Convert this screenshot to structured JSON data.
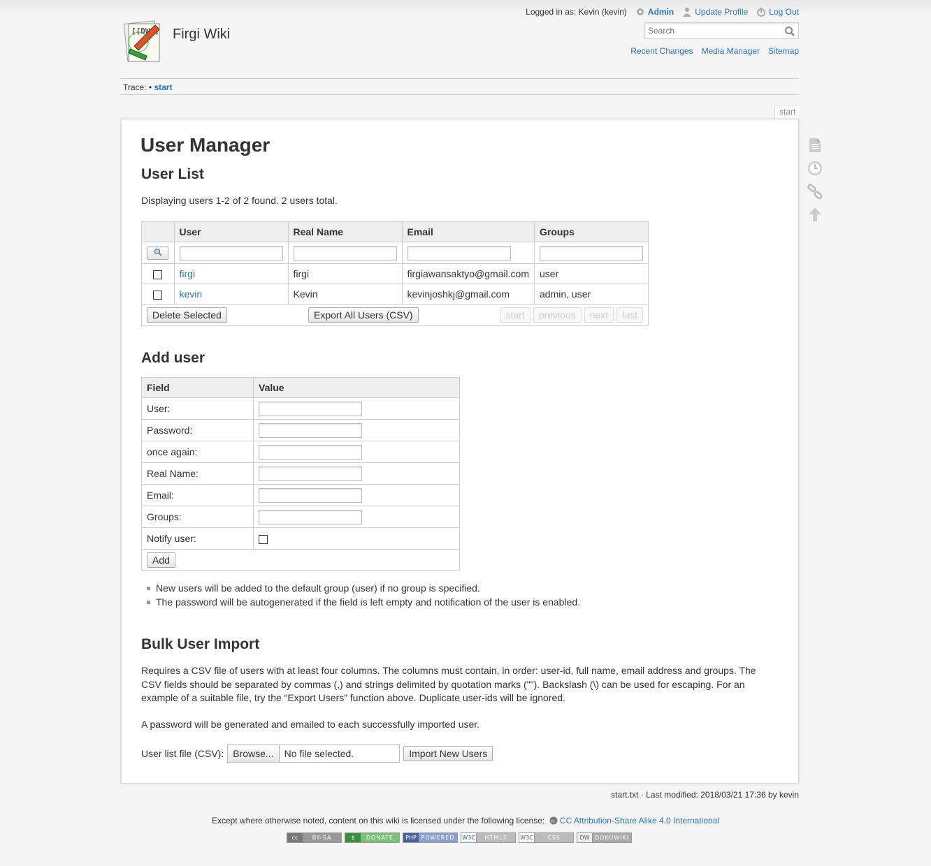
{
  "site": {
    "title": "Firgi Wiki",
    "logo_text": "[[DW]]"
  },
  "user_tools": {
    "logged_in": "Logged in as: Kevin (kevin)",
    "admin": "Admin",
    "update_profile": "Update Profile",
    "logout": "Log Out"
  },
  "search": {
    "placeholder": "Search"
  },
  "site_tools": {
    "recent_changes": "Recent Changes",
    "media_manager": "Media Manager",
    "sitemap": "Sitemap"
  },
  "breadcrumb": {
    "label": "Trace:",
    "sep": " • ",
    "item": "start"
  },
  "page_id": "start",
  "page": {
    "title": "User Manager",
    "user_list": {
      "heading": "User List",
      "summary": "Displaying users 1-2 of 2 found. 2 users total.",
      "columns": [
        "User",
        "Real Name",
        "Email",
        "Groups"
      ],
      "rows": [
        {
          "user": "firgi",
          "name": "firgi",
          "email": "firgiawansaktyo@gmail.com",
          "groups": "user"
        },
        {
          "user": "kevin",
          "name": "Kevin",
          "email": "kevinjoshkj@gmail.com",
          "groups": "admin, user"
        }
      ],
      "delete_selected": "Delete Selected",
      "export_all": "Export All Users (CSV)",
      "pager": {
        "start": "start",
        "previous": "previous",
        "next": "next",
        "last": "last"
      }
    },
    "add_user": {
      "heading": "Add user",
      "col_field": "Field",
      "col_value": "Value",
      "fields": [
        "User:",
        "Password:",
        "once again:",
        "Real Name:",
        "Email:",
        "Groups:"
      ],
      "notify": "Notify user:",
      "add_button": "Add",
      "notes": [
        "New users will be added to the default group (user) if no group is specified.",
        "The password will be autogenerated if the field is left empty and notification of the user is enabled."
      ]
    },
    "bulk_import": {
      "heading": "Bulk User Import",
      "para1": "Requires a CSV file of users with at least four columns. The columns must contain, in order: user-id, full name, email address and groups. The CSV fields should be separated by commas (,) and strings delimited by quotation marks (\"\"). Backslash (\\) can be used for escaping. For an example of a suitable file, try the “Export Users” function above. Duplicate user-ids will be ignored.",
      "para2": "A password will be generated and emailed to each successfully imported user.",
      "file_label": "User list file (CSV):",
      "browse": "Browse...",
      "no_file": "No file selected.",
      "import_button": "Import New Users"
    }
  },
  "doc_info": {
    "file": "start.txt",
    "modified": " · Last modified: 2018/03/21 17:36 by kevin"
  },
  "license": {
    "text": "Except where otherwise noted, content on this wiki is licensed under the following license:",
    "link": "CC Attribution-Share Alike 4.0 International"
  },
  "badges": [
    {
      "left": "cc",
      "right": "BY-SA"
    },
    {
      "left": "$",
      "right": "DONATE"
    },
    {
      "left": "PHP",
      "right": "POWERED"
    },
    {
      "left": "W3C",
      "right": "HTML5"
    },
    {
      "left": "W3C",
      "right": "CSS"
    },
    {
      "left": "DW",
      "right": "DOKUWIKI"
    }
  ]
}
